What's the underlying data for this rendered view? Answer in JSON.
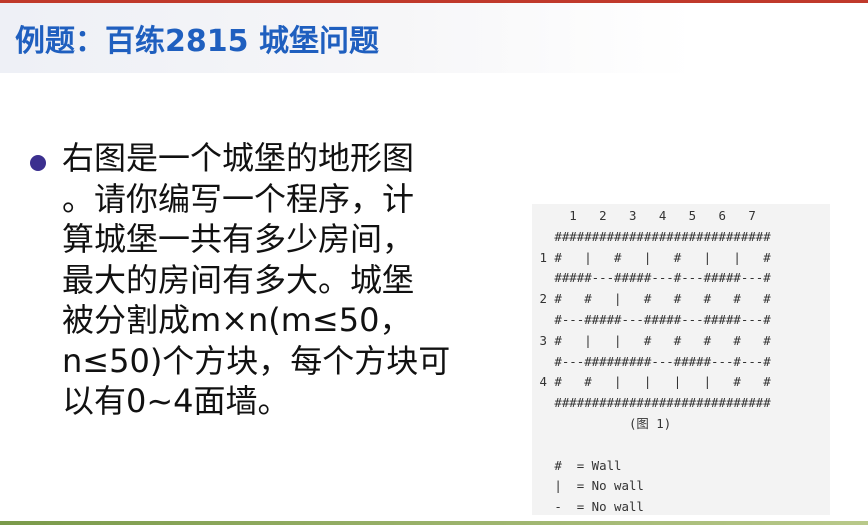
{
  "slide": {
    "title": "例题：百练2815 城堡问题",
    "bullet_lines": [
      "右图是一个城堡的地形图",
      "。请你编写一个程序，计",
      "算城堡一共有多少房间，",
      "最大的房间有多大。城堡",
      "被分割成m×n(m≤50，",
      "n≤50)个方块，每个方块可",
      "以有0~4面墙。"
    ]
  },
  "figure": {
    "column_numbers": "     1   2   3   4   5   6   7",
    "map_lines": [
      "   #############################",
      " 1 #   |   #   |   #   |   |   #",
      "   #####---#####---#---#####---#",
      " 2 #   #   |   #   #   #   #   #",
      "   #---#####---#####---#####---#",
      " 3 #   |   |   #   #   #   #   #",
      "   #---#########---#####---#---#",
      " 4 #   #   |   |   |   |   #   #",
      "   #############################"
    ],
    "caption": "             (图 1)",
    "legend": [
      "   #  = Wall",
      "   |  = No wall",
      "   -  = No wall"
    ]
  }
}
